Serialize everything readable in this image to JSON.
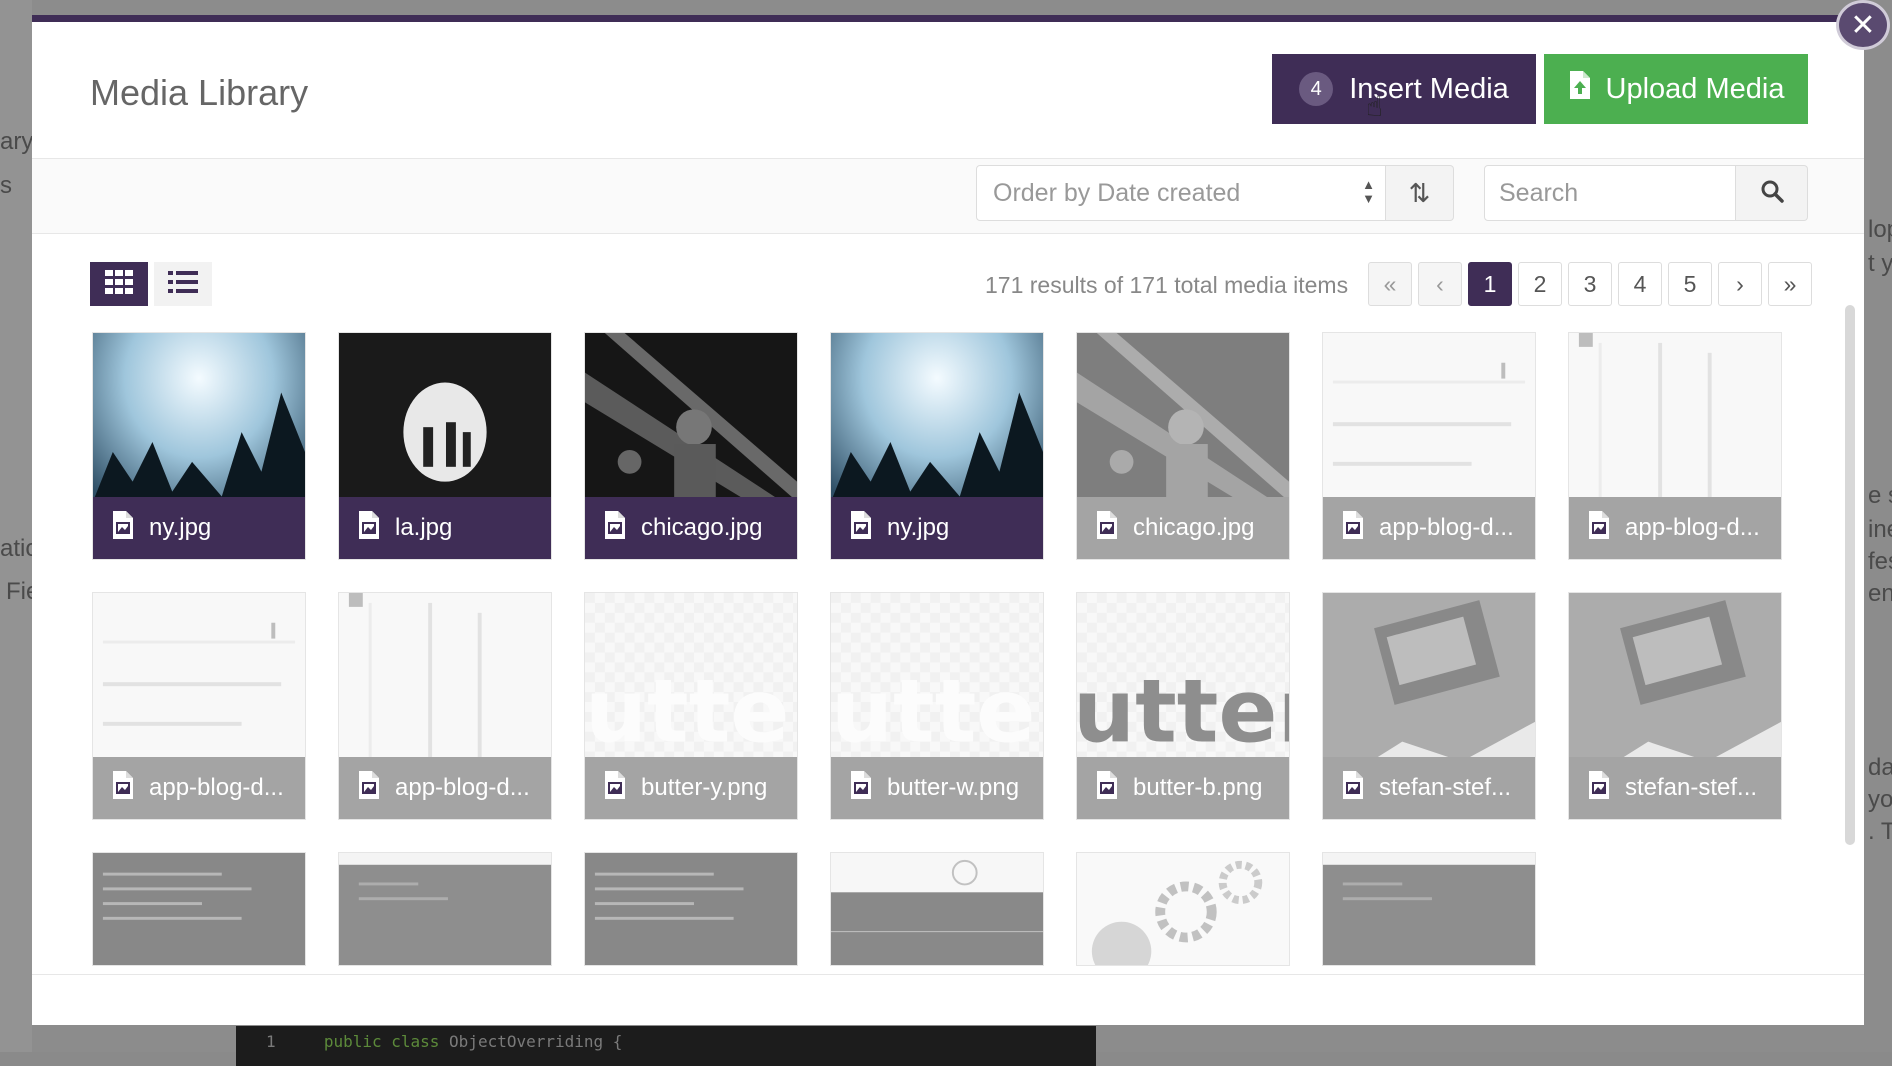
{
  "backdrop": {
    "left_fragments": [
      "ary",
      "s",
      "atio",
      "Fie"
    ],
    "right_fragments": [
      "lop",
      "t y",
      "e s",
      "ine",
      "fes",
      "en",
      "da",
      "you",
      ". T"
    ],
    "code_line_number": "1",
    "code_keyword": "public class",
    "code_rest": "ObjectOverriding {"
  },
  "modal": {
    "title": "Media Library",
    "close_icon": "close-icon",
    "insert": {
      "count": "4",
      "label": "Insert Media"
    },
    "upload": {
      "label": "Upload Media"
    }
  },
  "toolbar": {
    "order_value": "Order by Date created",
    "search_placeholder": "Search"
  },
  "results": {
    "summary": "171 results of 171 total media items"
  },
  "pagination": {
    "first": "«",
    "prev": "‹",
    "pages": [
      "1",
      "2",
      "3",
      "4",
      "5"
    ],
    "active_page": "1",
    "next": "›",
    "last": "»"
  },
  "media": [
    {
      "name": "ny.jpg",
      "selected": true,
      "thumb": "concert-crowd"
    },
    {
      "name": "la.jpg",
      "selected": true,
      "thumb": "concert-silhouette"
    },
    {
      "name": "chicago.jpg",
      "selected": true,
      "thumb": "guitarist"
    },
    {
      "name": "ny.jpg",
      "selected": true,
      "thumb": "concert-crowd"
    },
    {
      "name": "chicago.jpg",
      "selected": false,
      "thumb": "guitarist"
    },
    {
      "name": "app-blog-d...",
      "selected": false,
      "thumb": "screenshot"
    },
    {
      "name": "app-blog-d...",
      "selected": false,
      "thumb": "screenshot-rotated"
    },
    {
      "name": "app-blog-d...",
      "selected": false,
      "thumb": "screenshot"
    },
    {
      "name": "app-blog-d...",
      "selected": false,
      "thumb": "screenshot-rotated"
    },
    {
      "name": "butter-y.png",
      "selected": false,
      "thumb": "butter-logo-light"
    },
    {
      "name": "butter-w.png",
      "selected": false,
      "thumb": "butter-logo-light"
    },
    {
      "name": "butter-b.png",
      "selected": false,
      "thumb": "butter-logo-dark"
    },
    {
      "name": "stefan-stef...",
      "selected": false,
      "thumb": "laptop-hands"
    },
    {
      "name": "stefan-stef...",
      "selected": false,
      "thumb": "laptop-hands"
    }
  ],
  "partial_row": [
    "code-screenshot",
    "dark-screenshot",
    "code-screenshot",
    "diagram-screenshot",
    "gears",
    "dark-screenshot"
  ],
  "colors": {
    "primary": "#3f2d56",
    "upload": "#4caf50",
    "selected_label": "#3f2d56",
    "unselected_label": "#a4a4a4"
  }
}
